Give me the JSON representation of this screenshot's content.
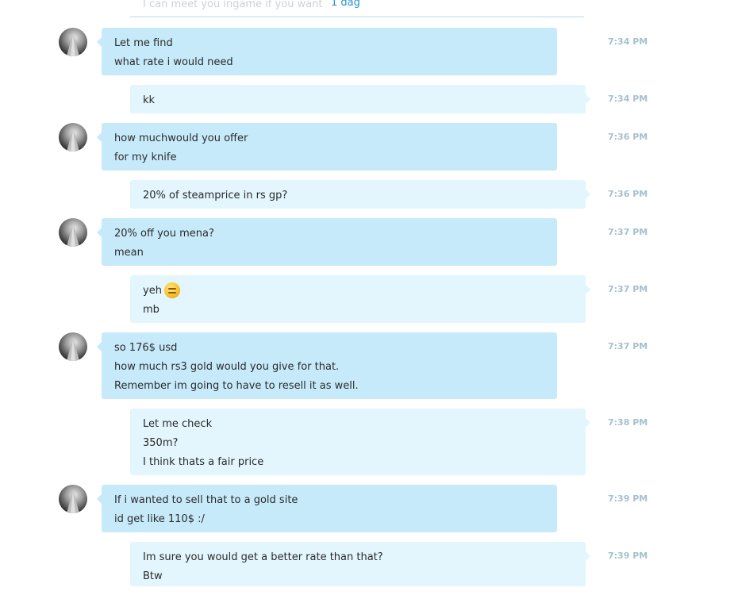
{
  "history": {
    "faded_text": "I can meet you ingame if you want",
    "date_label": "1 dag"
  },
  "messages": [
    {
      "lines": [
        "Let me find",
        "what rate i would need"
      ],
      "time": "7:34 PM"
    },
    {
      "lines": [
        "kk"
      ],
      "time": "7:34 PM"
    },
    {
      "lines": [
        "how muchwould you offer",
        "for my knife"
      ],
      "time": "7:36 PM"
    },
    {
      "lines": [
        "20% of steamprice in rs gp?"
      ],
      "time": "7:36 PM"
    },
    {
      "lines": [
        "20% off you mena?",
        "mean"
      ],
      "time": "7:37 PM"
    },
    {
      "lines": [
        "yeh",
        "mb"
      ],
      "emoticon": "deadpan-emoticon",
      "time": "7:37 PM"
    },
    {
      "lines": [
        "so 176$ usd",
        "how much rs3 gold would you give for that.",
        "Remember im going to have to resell it as well."
      ],
      "time": "7:37 PM"
    },
    {
      "lines": [
        "Let me check",
        "350m?",
        "I think thats a fair price"
      ],
      "time": "7:38 PM"
    },
    {
      "lines": [
        "If i wanted to sell that to a gold site",
        "id get like 110$ :/"
      ],
      "time": "7:39 PM"
    },
    {
      "lines": [
        "Im sure you would get a better rate than that?",
        "Btw"
      ],
      "time": "7:39 PM"
    }
  ],
  "colors": {
    "incoming_bubble": "#c7eafb",
    "outgoing_bubble": "#e3f5fd",
    "timestamp": "#a4c0cf",
    "date_link": "#2a93d5"
  }
}
